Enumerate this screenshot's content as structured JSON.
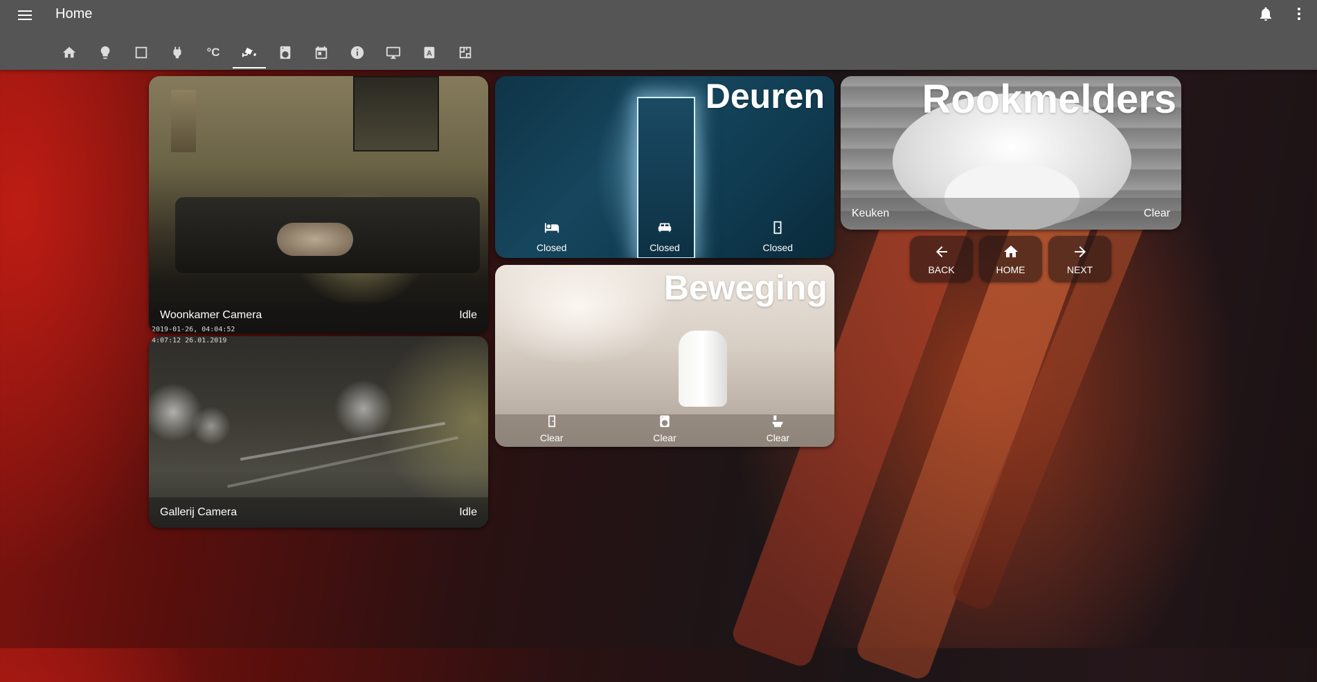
{
  "header": {
    "title": "Home",
    "tabs": [
      {
        "icon": "home-icon"
      },
      {
        "icon": "lightbulb-icon"
      },
      {
        "icon": "square-icon"
      },
      {
        "icon": "power-plug-icon"
      },
      {
        "icon": "thermometer-celsius-icon",
        "text": "°C"
      },
      {
        "icon": "cctv-icon",
        "active": true
      },
      {
        "icon": "washing-machine-icon"
      },
      {
        "icon": "calendar-icon"
      },
      {
        "icon": "information-icon"
      },
      {
        "icon": "monitor-icon"
      },
      {
        "icon": "alpha-a-box-icon",
        "text": "A"
      },
      {
        "icon": "floor-plan-icon"
      }
    ]
  },
  "cameras": [
    {
      "name": "Woonkamer Camera",
      "state": "Idle",
      "timestamp": "2019-01-26, 04:04:52"
    },
    {
      "name": "Gallerij Camera",
      "state": "Idle",
      "timestamp": "4:07:12 26.01.2019"
    }
  ],
  "doors": {
    "title": "Deuren",
    "items": [
      {
        "icon": "bed-icon",
        "state": "Closed"
      },
      {
        "icon": "bed-double-icon",
        "state": "Closed"
      },
      {
        "icon": "door-icon",
        "state": "Closed"
      }
    ]
  },
  "motion": {
    "title": "Beweging",
    "items": [
      {
        "icon": "door-icon",
        "state": "Clear"
      },
      {
        "icon": "washing-machine-icon",
        "state": "Clear"
      },
      {
        "icon": "toilet-icon",
        "state": "Clear"
      }
    ]
  },
  "smoke": {
    "title": "Rookmelders",
    "sensor": "Keuken",
    "state": "Clear"
  },
  "nav": {
    "back": "BACK",
    "home": "HOME",
    "next": "NEXT"
  },
  "colors": {
    "toolbar": "#555555",
    "accent_red": "#8a1410"
  }
}
